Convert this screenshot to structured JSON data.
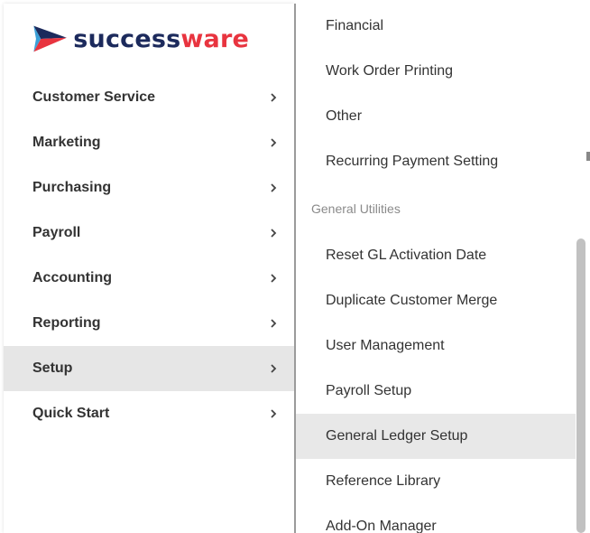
{
  "brand": {
    "name_part1": "success",
    "name_part2": "ware",
    "colors": {
      "navy": "#1c2a5c",
      "red": "#e8343f",
      "blue": "#3aa0d8"
    }
  },
  "left_menu": {
    "items": [
      {
        "label": "Customer Service",
        "icon": "chevron-right-icon"
      },
      {
        "label": "Marketing",
        "icon": "chevron-right-icon"
      },
      {
        "label": "Purchasing",
        "icon": "chevron-right-icon"
      },
      {
        "label": "Payroll",
        "icon": "chevron-right-icon"
      },
      {
        "label": "Accounting",
        "icon": "chevron-right-icon"
      },
      {
        "label": "Reporting",
        "icon": "chevron-right-icon"
      },
      {
        "label": "Setup",
        "icon": "chevron-right-icon",
        "active": true
      },
      {
        "label": "Quick Start",
        "icon": "chevron-right-icon"
      }
    ]
  },
  "submenu": {
    "items_top": [
      "Financial",
      "Work Order Printing",
      "Other",
      "Recurring Payment Setting"
    ],
    "heading": "General Utilities",
    "items_bottom": [
      "Reset GL Activation Date",
      "Duplicate Customer Merge",
      "User Management",
      "Payroll Setup",
      "General Ledger Setup",
      "Reference Library",
      "Add-On Manager"
    ],
    "hovered": "General Ledger Setup"
  }
}
